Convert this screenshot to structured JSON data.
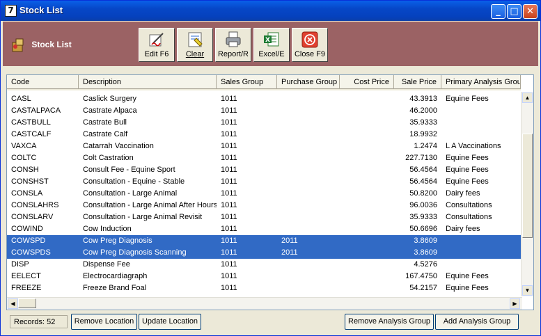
{
  "window": {
    "title": "Stock List",
    "app_glyph": "7"
  },
  "toolbar": {
    "title": "Stock List",
    "buttons": [
      {
        "label": "Edit F6",
        "icon": "edit-icon"
      },
      {
        "label": "Clear",
        "icon": "clear-icon"
      },
      {
        "label": "Report/R",
        "icon": "printer-icon"
      },
      {
        "label": "Excel/E",
        "icon": "excel-icon"
      },
      {
        "label": "Close F9",
        "icon": "close-icon"
      }
    ]
  },
  "grid": {
    "columns": [
      "Code",
      "Description",
      "Sales Group",
      "Purchase Group",
      "Cost Price",
      "Sale Price",
      "Primary Analysis Group"
    ],
    "rows": [
      {
        "code": "CASL",
        "desc": "Caslick Surgery",
        "sg": "1011",
        "pg": "",
        "cp": "",
        "sp": "43.3913",
        "ag": "Equine Fees",
        "selected": false
      },
      {
        "code": "CASTALPACA",
        "desc": "Castrate Alpaca",
        "sg": "1011",
        "pg": "",
        "cp": "",
        "sp": "46.2000",
        "ag": "",
        "selected": false
      },
      {
        "code": "CASTBULL",
        "desc": "Castrate Bull",
        "sg": "1011",
        "pg": "",
        "cp": "",
        "sp": "35.9333",
        "ag": "",
        "selected": false
      },
      {
        "code": "CASTCALF",
        "desc": "Castrate Calf",
        "sg": "1011",
        "pg": "",
        "cp": "",
        "sp": "18.9932",
        "ag": "",
        "selected": false
      },
      {
        "code": "VAXCA",
        "desc": "Catarrah Vaccination",
        "sg": "1011",
        "pg": "",
        "cp": "",
        "sp": "1.2474",
        "ag": "L A Vaccinations",
        "selected": false
      },
      {
        "code": "COLTC",
        "desc": "Colt Castration",
        "sg": "1011",
        "pg": "",
        "cp": "",
        "sp": "227.7130",
        "ag": "Equine Fees",
        "selected": false
      },
      {
        "code": "CONSH",
        "desc": "Consult Fee - Equine Sport",
        "sg": "1011",
        "pg": "",
        "cp": "",
        "sp": "56.4564",
        "ag": "Equine Fees",
        "selected": false
      },
      {
        "code": "CONSHST",
        "desc": "Consultation - Equine - Stable",
        "sg": "1011",
        "pg": "",
        "cp": "",
        "sp": "56.4564",
        "ag": "Equine Fees",
        "selected": false
      },
      {
        "code": "CONSLA",
        "desc": "Consultation - Large Animal",
        "sg": "1011",
        "pg": "",
        "cp": "",
        "sp": "50.8200",
        "ag": "Dairy fees",
        "selected": false
      },
      {
        "code": "CONSLAHRS",
        "desc": "Consultation - Large Animal After Hours",
        "sg": "1011",
        "pg": "",
        "cp": "",
        "sp": "96.0036",
        "ag": "Consultations",
        "selected": false
      },
      {
        "code": "CONSLARV",
        "desc": "Consultation - Large Animal Revisit",
        "sg": "1011",
        "pg": "",
        "cp": "",
        "sp": "35.9333",
        "ag": "Consultations",
        "selected": false
      },
      {
        "code": "COWIND",
        "desc": "Cow Induction",
        "sg": "1011",
        "pg": "",
        "cp": "",
        "sp": "50.6696",
        "ag": "Dairy fees",
        "selected": false
      },
      {
        "code": "COWSPD",
        "desc": "Cow Preg Diagnosis",
        "sg": "1011",
        "pg": "2011",
        "cp": "",
        "sp": "3.8609",
        "ag": "",
        "selected": true
      },
      {
        "code": "COWSPDS",
        "desc": "Cow Preg Diagnosis Scanning",
        "sg": "1011",
        "pg": "2011",
        "cp": "",
        "sp": "3.8609",
        "ag": "",
        "selected": true
      },
      {
        "code": "DISP",
        "desc": "Dispense Fee",
        "sg": "1011",
        "pg": "",
        "cp": "",
        "sp": "4.5276",
        "ag": "",
        "selected": false
      },
      {
        "code": "EELECT",
        "desc": "Electrocardiagraph",
        "sg": "1011",
        "pg": "",
        "cp": "",
        "sp": "167.4750",
        "ag": "Equine Fees",
        "selected": false
      },
      {
        "code": "FREEZE",
        "desc": "Freeze Brand Foal",
        "sg": "1011",
        "pg": "",
        "cp": "",
        "sp": "54.2157",
        "ag": "Equine Fees",
        "selected": false
      }
    ]
  },
  "status": {
    "records": "Records: 52",
    "buttons": {
      "remove_location": "Remove Location",
      "update_location": "Update Location",
      "remove_analysis": "Remove Analysis Group",
      "add_analysis": "Add Analysis Group"
    }
  },
  "colors": {
    "accent": "#9B6264",
    "selection": "#316AC5",
    "titlebar": "#0A5FE8"
  }
}
